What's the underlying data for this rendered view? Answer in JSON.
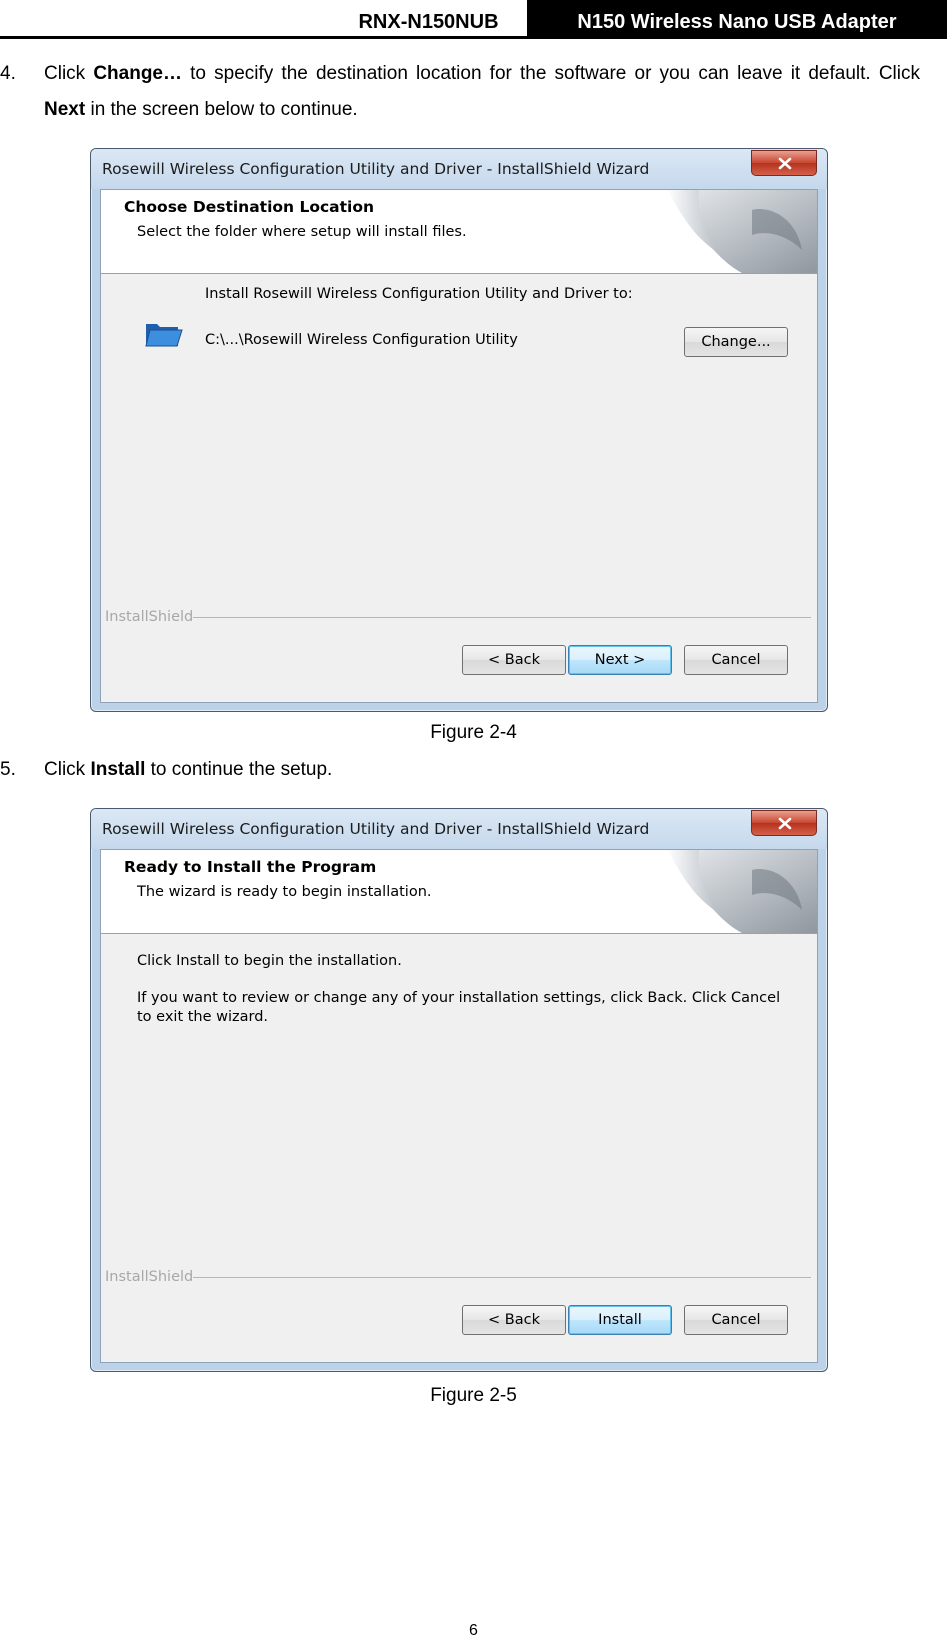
{
  "header": {
    "model": "RNX-N150NUB",
    "product": "N150 Wireless Nano USB Adapter"
  },
  "step4": {
    "number": "4.",
    "pre": "Click ",
    "bold1": "Change…",
    "mid": " to specify the destination location for the software or you can leave it default. Click ",
    "bold2": "Next",
    "post": " in the screen below to continue."
  },
  "figure1": {
    "window_title": "Rosewill Wireless Configuration Utility and Driver - InstallShield Wizard",
    "banner_title": "Choose Destination Location",
    "banner_subtitle": "Select the folder where setup will install files.",
    "install_label": "Install Rosewill Wireless Configuration Utility and Driver to:",
    "install_path": "C:\\...\\Rosewill Wireless Configuration Utility",
    "change_button": "Change...",
    "brand": "InstallShield",
    "back_button": "< Back",
    "next_button": "Next >",
    "cancel_button": "Cancel",
    "caption": "Figure 2-4"
  },
  "step5": {
    "number": "5.",
    "pre": "Click ",
    "bold1": "Install",
    "post": " to continue the setup."
  },
  "figure2": {
    "window_title": "Rosewill Wireless Configuration Utility and Driver - InstallShield Wizard",
    "banner_title": "Ready to Install the Program",
    "banner_subtitle": "The wizard is ready to begin installation.",
    "line1": "Click Install to begin the installation.",
    "line2": "If you want to review or change any of your installation settings, click Back. Click Cancel to exit the wizard.",
    "brand": "InstallShield",
    "back_button": "< Back",
    "install_button": "Install",
    "cancel_button": "Cancel",
    "caption": "Figure 2-5"
  },
  "page_number": "6",
  "colors": {
    "header_band": "#000000",
    "dialog_frame": "#bcd2e8",
    "dialog_client": "#f0f0f0",
    "close_button": "#c8452f",
    "default_button_border": "#3c7fb1"
  }
}
